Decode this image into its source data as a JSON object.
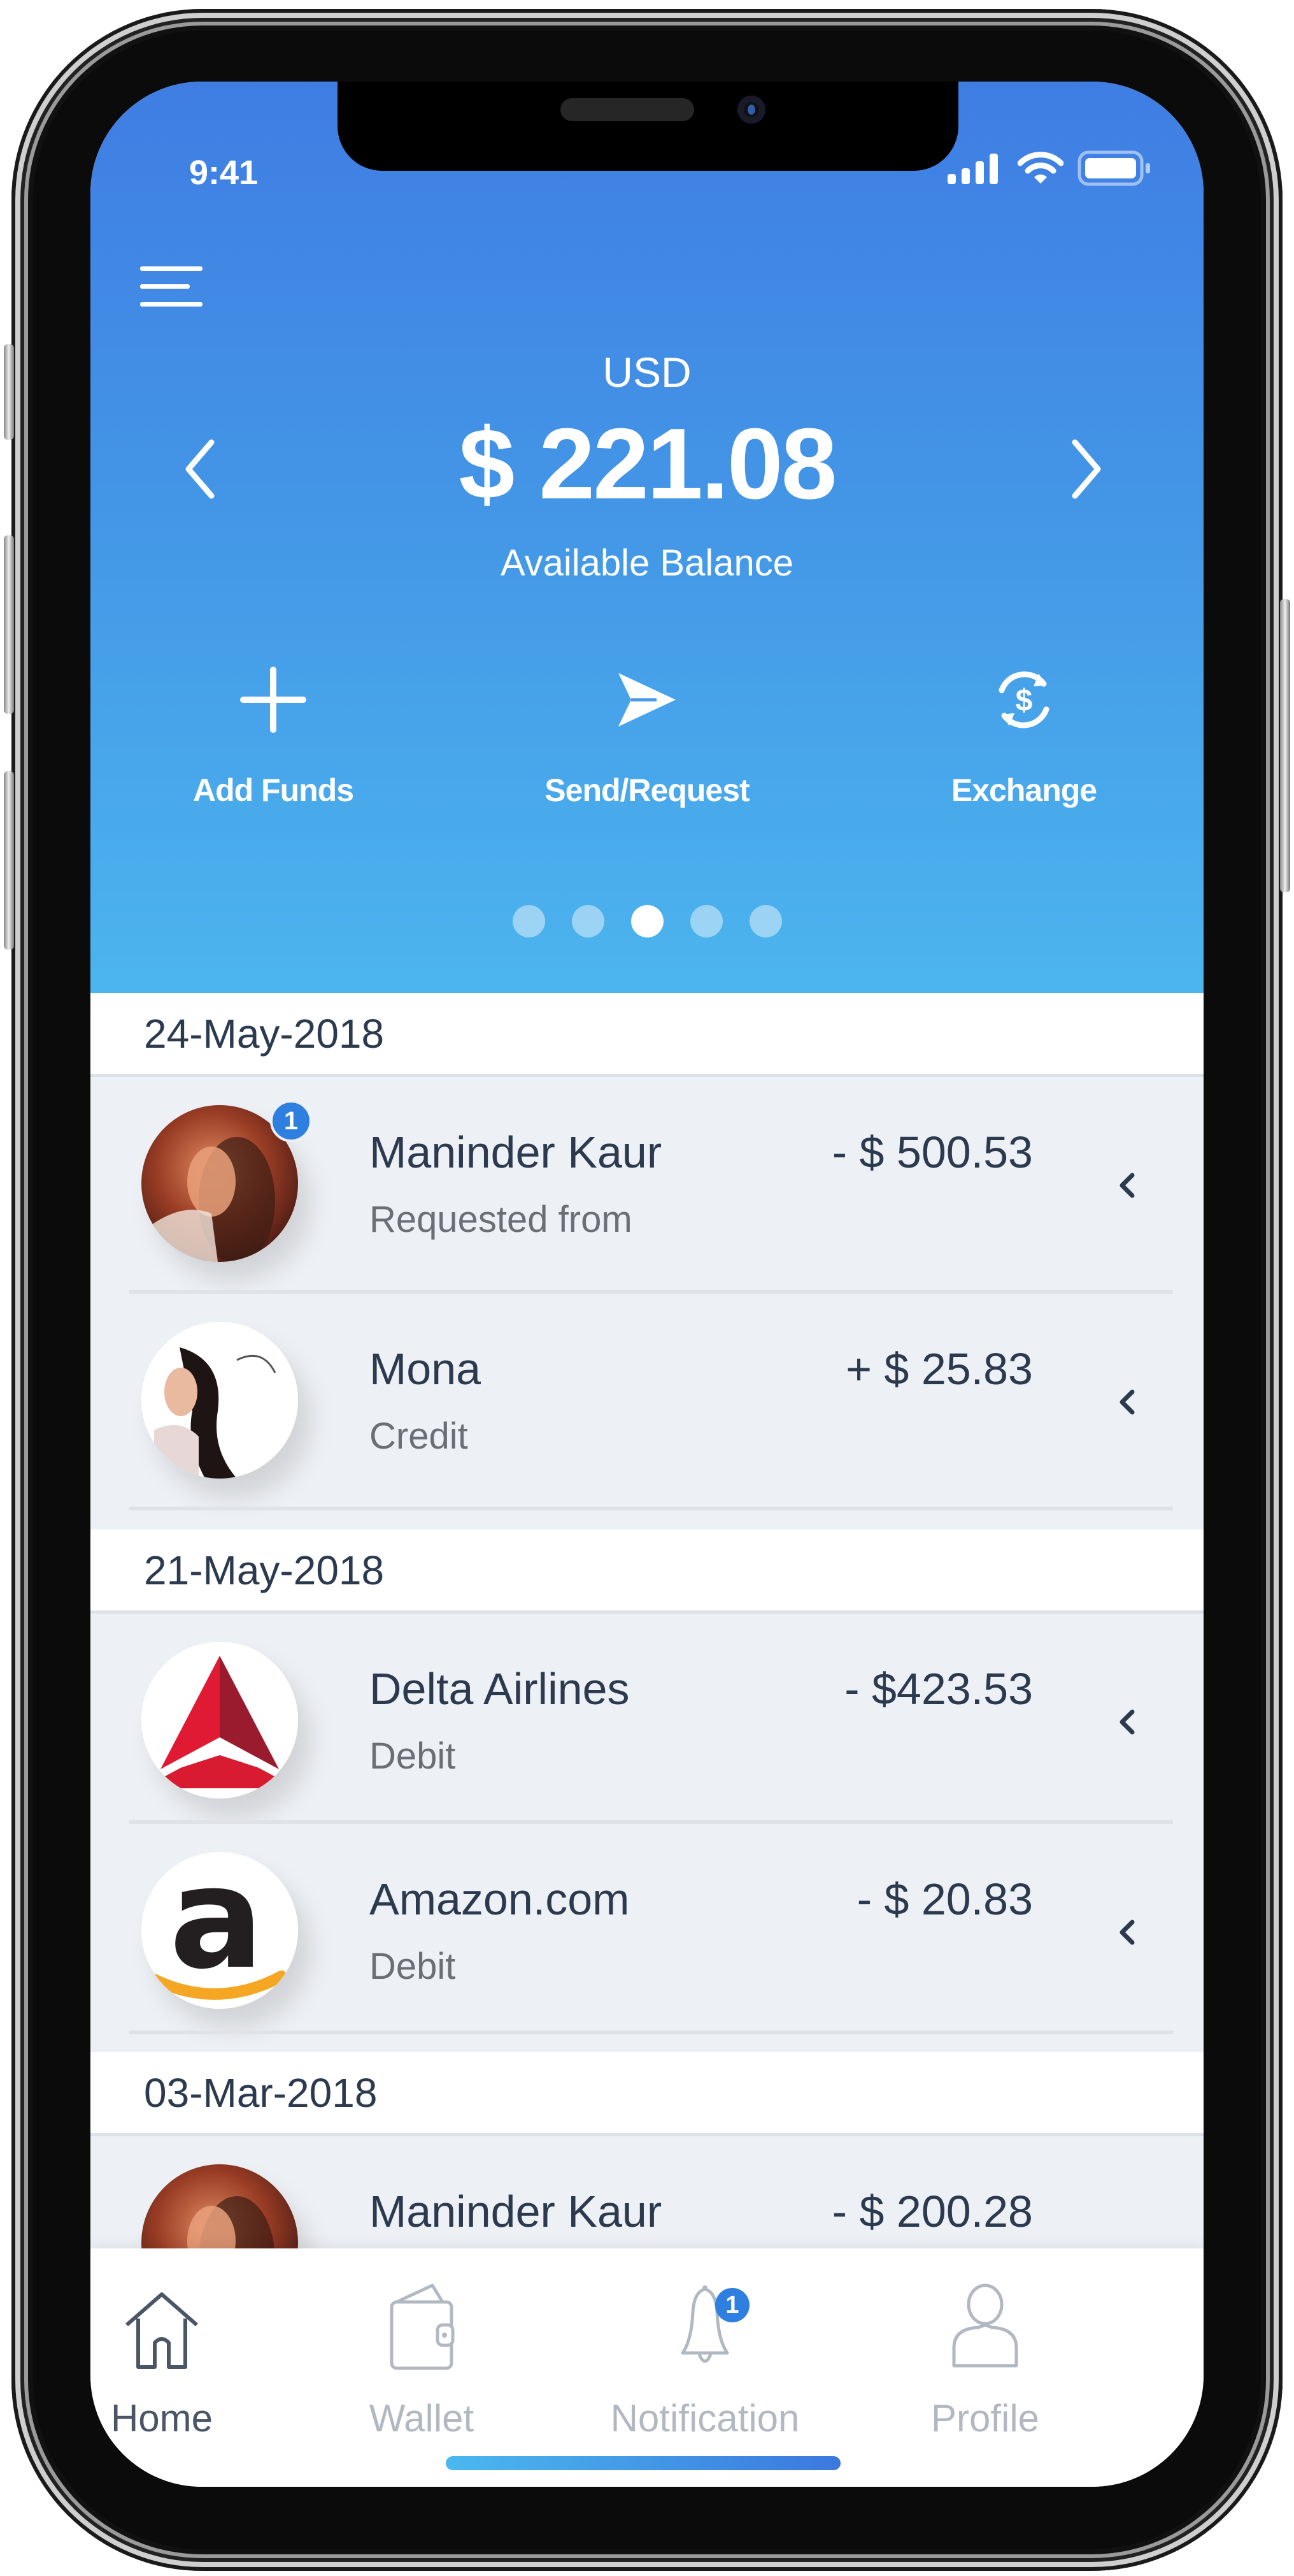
{
  "status_bar": {
    "time": "9:41",
    "signal_icon": "signal-bars-icon",
    "wifi_icon": "wifi-icon",
    "battery_icon": "battery-icon"
  },
  "header": {
    "menu_icon": "hamburger-menu-icon",
    "currency": "USD",
    "balance": "$ 221.08",
    "balance_label": "Available Balance",
    "prev_icon": "chevron-left-icon",
    "next_icon": "chevron-right-icon",
    "gradient": [
      "#3f7de3",
      "#4cb5ee"
    ],
    "actions": [
      {
        "label": "Add Funds",
        "icon": "plus-icon"
      },
      {
        "label": "Send/Request",
        "icon": "send-icon"
      },
      {
        "label": "Exchange",
        "icon": "currency-exchange-icon"
      }
    ],
    "pager": {
      "count": 5,
      "active_index": 2
    }
  },
  "transactions": [
    {
      "date": "24-May-2018",
      "items": [
        {
          "name": "Maninder Kaur",
          "type": "Requested from",
          "amount": "- $ 500.53",
          "avatar": "photo-maninder",
          "badge": "1"
        },
        {
          "name": "Mona",
          "type": "Credit",
          "amount": "+ $ 25.83",
          "avatar": "photo-mona"
        }
      ]
    },
    {
      "date": "21-May-2018",
      "items": [
        {
          "name": "Delta Airlines",
          "type": "Debit",
          "amount": "- $423.53",
          "avatar": "delta-logo"
        },
        {
          "name": "Amazon.com",
          "type": "Debit",
          "amount": "- $ 20.83",
          "avatar": "amazon-logo"
        }
      ]
    },
    {
      "date": "03-Mar-2018",
      "items": [
        {
          "name": "Maninder Kaur",
          "type": "",
          "amount": "- $ 200.28",
          "avatar": "photo-maninder"
        }
      ]
    }
  ],
  "tabbar": {
    "items": [
      {
        "label": "Home",
        "icon": "home-icon",
        "active": true
      },
      {
        "label": "Wallet",
        "icon": "wallet-icon"
      },
      {
        "label": "Notification",
        "icon": "bell-icon",
        "badge": "1"
      },
      {
        "label": "Profile",
        "icon": "user-icon"
      }
    ]
  },
  "colors": {
    "accent": "#2f7fe0",
    "text_dark": "#2b3a4f",
    "text_muted": "#6a6f76",
    "row_bg": "#edf0f4",
    "tab_inactive": "#b2b8c2"
  }
}
